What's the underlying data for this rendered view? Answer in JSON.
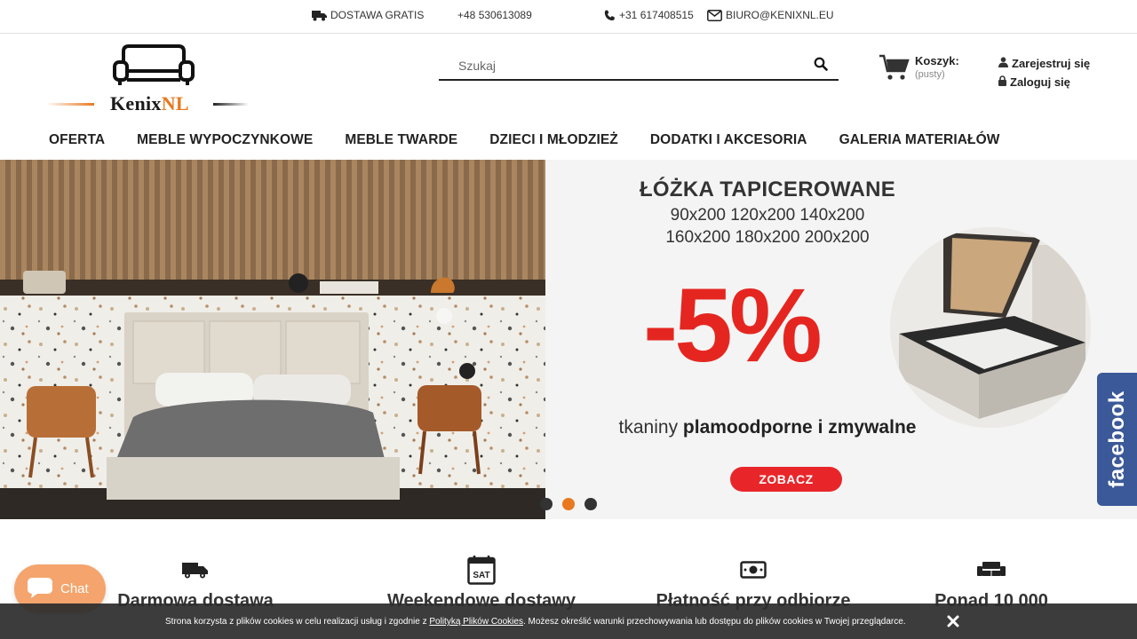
{
  "topbar": {
    "shipping": "DOSTAWA GRATIS",
    "phone_pl": "+48 530613089",
    "phone_nl": "+31 617408515",
    "email": "BIURO@KENIXNL.EU"
  },
  "logo": {
    "name_a": "Kenix",
    "name_b": "NL"
  },
  "search": {
    "placeholder": "Szukaj"
  },
  "cart": {
    "label": "Koszyk:",
    "status": "(pusty)"
  },
  "account": {
    "register": "Zarejestruj się",
    "login": "Zaloguj się"
  },
  "nav": [
    "OFERTA",
    "MEBLE WYPOCZYNKOWE",
    "MEBLE TWARDE",
    "DZIECI I MŁODZIEŻ",
    "DODATKI I AKCESORIA",
    "GALERIA MATERIAŁÓW"
  ],
  "hero": {
    "title": "ŁÓŻKA TAPICEROWANE",
    "sizes_1": "90x200 120x200 140x200",
    "sizes_2": "160x200 180x200 200x200",
    "discount": "-5%",
    "fabric_pre": "tkaniny ",
    "fabric_bold": "plamoodporne i zmywalne",
    "cta": "ZOBACZ",
    "slide_count": 3,
    "active_slide": 2
  },
  "facebook": {
    "label": "facebook",
    "color": "#3b5998"
  },
  "features": [
    {
      "icon": "truck-icon",
      "label": "Darmowa dostawa"
    },
    {
      "icon": "calendar-sat-icon",
      "label": "Weekendowe dostawy"
    },
    {
      "icon": "cash-icon",
      "label": "Płatność przy odbiorze"
    },
    {
      "icon": "sofa-icon",
      "label": "Ponad 10 000"
    }
  ],
  "chat": {
    "label": "Chat"
  },
  "cookie": {
    "text_before": "Strona korzysta z plików cookies w celu realizacji usług i zgodnie z ",
    "link": "Polityką Plików Cookies",
    "text_after": ". Możesz określić warunki przechowywania lub dostępu do plików cookies w Twojej przeglądarce."
  },
  "colors": {
    "accent": "#e8791f",
    "sale_red": "#e52620",
    "cta_red": "#e8262a"
  }
}
